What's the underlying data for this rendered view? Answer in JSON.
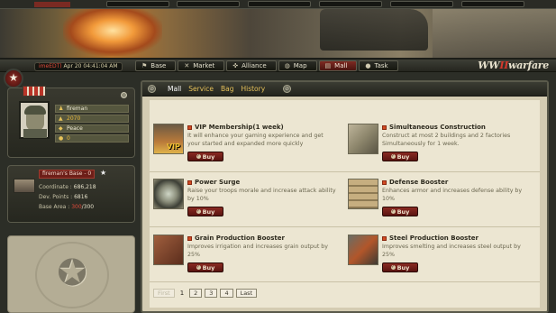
{
  "header": {
    "server_time": {
      "red_prefix": "imeEDT)",
      "value": "Apr 20 04:41:04 AM"
    },
    "logo": {
      "prefix": "WW",
      "mark": "II",
      "suffix": "warfare"
    }
  },
  "nav_tabs": [
    {
      "label": "Base",
      "icon": "flag-icon"
    },
    {
      "label": "Market",
      "icon": "tools-icon"
    },
    {
      "label": "Alliance",
      "icon": "handshake-icon"
    },
    {
      "label": "Map",
      "icon": "globe-icon"
    },
    {
      "label": "Mall",
      "icon": "cart-icon",
      "active": true
    },
    {
      "label": "Task",
      "icon": "bullet-icon"
    }
  ],
  "player": {
    "name": "fireman",
    "value1": "2070",
    "status": "Peace",
    "value2": "0"
  },
  "base": {
    "title": "fireman's Base - 0",
    "coordinate_label": "Coordinate :",
    "coordinate_value": "686,218",
    "dev_points_label": "Dev. Points :",
    "dev_points_value": "6816",
    "base_area_label": "Base Area :",
    "base_area_used": "300",
    "base_area_total": "/300"
  },
  "subnav": {
    "links": [
      "Mall",
      "Service",
      "Bag",
      "History"
    ],
    "current": "Mall"
  },
  "items": [
    {
      "title": "VIP Membership(1 week)",
      "desc": "It will enhance your gaming experience and get your started and expanded more quickly",
      "pic": "vip",
      "pic_label": "VIP",
      "buy": "Buy"
    },
    {
      "title": "Simultaneous Construction",
      "desc": "Construct at most 2 buildings and 2 factories Simultaneously for 1 week.",
      "pic": "box",
      "pic_label": "",
      "buy": "Buy"
    },
    {
      "title": "Power Surge",
      "desc": "Raise your troops morale and increase attack ability by 10%",
      "pic": "scope",
      "pic_label": "",
      "buy": "Buy"
    },
    {
      "title": "Defense Booster",
      "desc": "Enhances armor and increases defense ability by 10%",
      "pic": "sand",
      "pic_label": "",
      "buy": "Buy"
    },
    {
      "title": "Grain Production Booster",
      "desc": "Improves irrigation and increases grain output by 25%",
      "pic": "crate",
      "pic_label": "",
      "buy": "Buy"
    },
    {
      "title": "Steel Production Booster",
      "desc": "Improves smelting and increases steel output by 25%",
      "pic": "steel",
      "pic_label": "",
      "buy": "Buy"
    }
  ],
  "pager": {
    "first": "First",
    "pages": [
      "1",
      "2",
      "3",
      "4"
    ],
    "current": "1",
    "last": "Last"
  }
}
